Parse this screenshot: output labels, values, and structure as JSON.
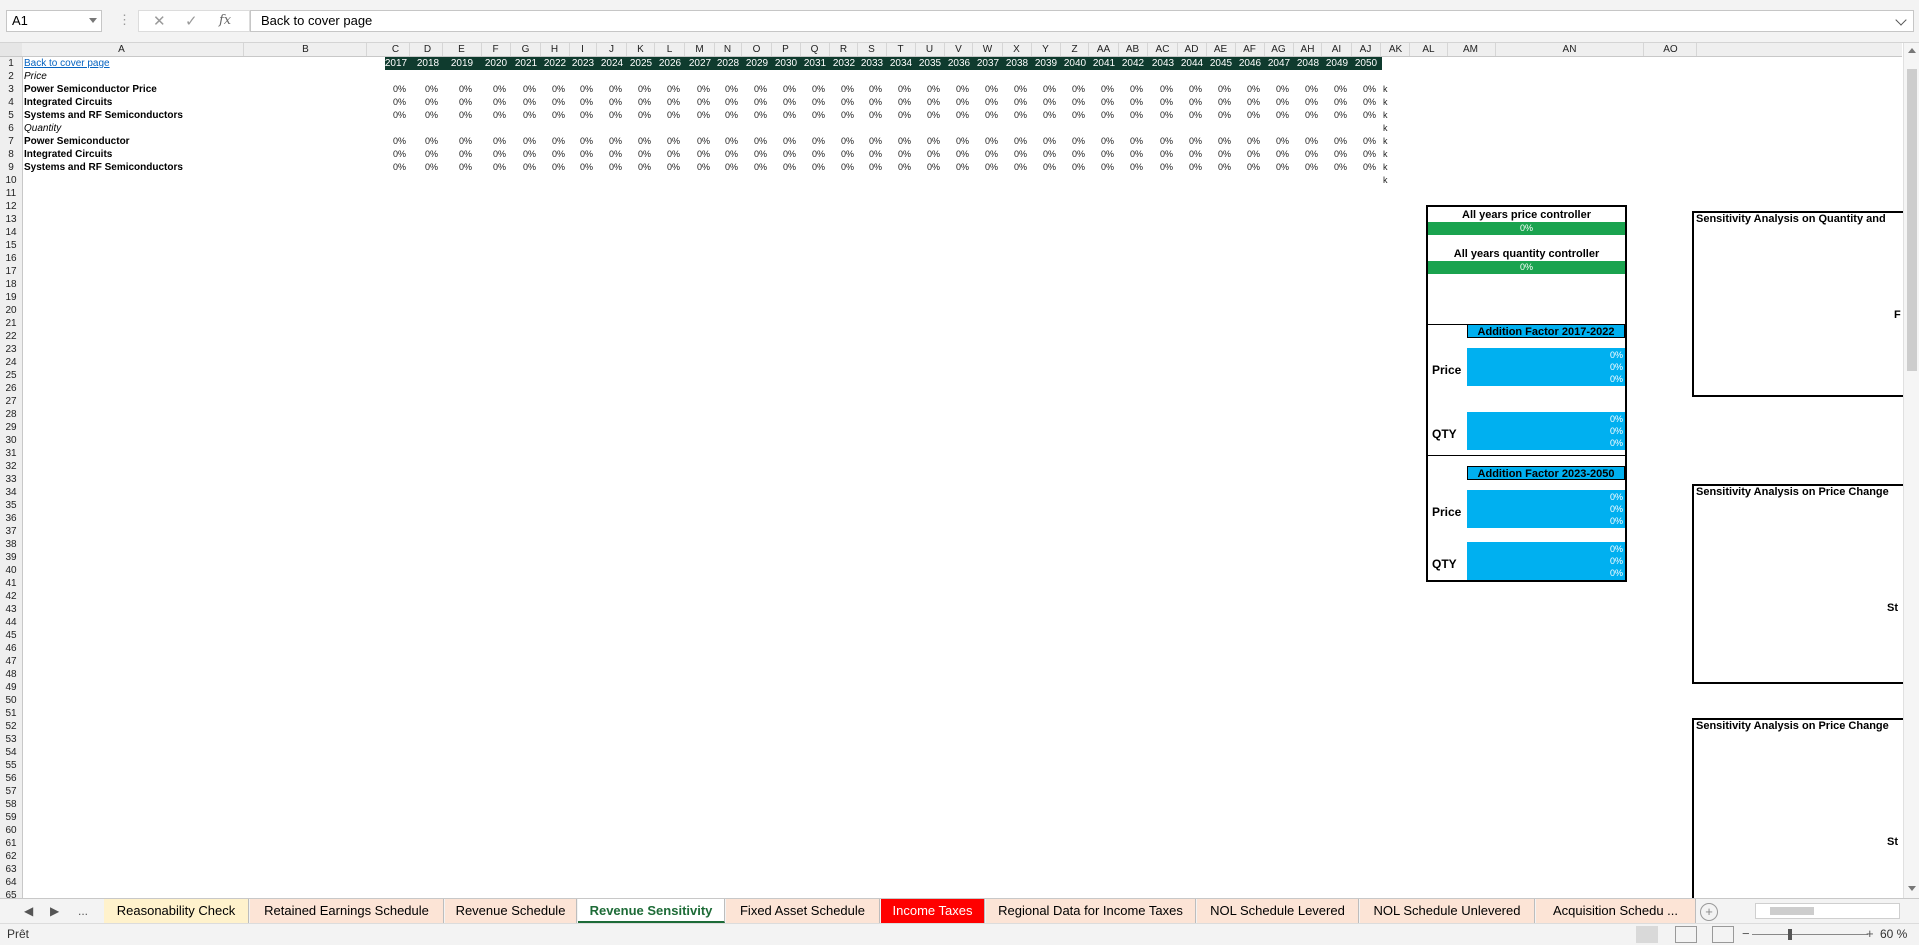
{
  "formula_bar": {
    "name_box": "A1",
    "separator": "⋮",
    "cancel_icon": "✕",
    "enter_icon": "✓",
    "fx_icon": "fx",
    "content": "Back to cover page"
  },
  "columns": [
    "A",
    "B",
    "C",
    "D",
    "E",
    "F",
    "G",
    "H",
    "I",
    "J",
    "K",
    "L",
    "M",
    "N",
    "O",
    "P",
    "Q",
    "R",
    "S",
    "T",
    "U",
    "V",
    "W",
    "X",
    "Y",
    "Z",
    "AA",
    "AB",
    "AC",
    "AD",
    "AE",
    "AF",
    "AG",
    "AH",
    "AI",
    "AJ",
    "AK",
    "AL",
    "AM",
    "AN",
    "AO"
  ],
  "rows": [
    "1",
    "2",
    "3",
    "4",
    "5",
    "6",
    "7",
    "8",
    "9",
    "10",
    "11",
    "12",
    "13",
    "14",
    "15",
    "16",
    "17",
    "18",
    "19",
    "20",
    "21",
    "22",
    "23",
    "24",
    "25",
    "26",
    "27",
    "28",
    "29",
    "30",
    "31",
    "32",
    "33",
    "34",
    "35",
    "36",
    "37",
    "38",
    "39",
    "40",
    "41",
    "42",
    "43",
    "44",
    "45",
    "46",
    "47",
    "48",
    "49",
    "50",
    "51",
    "52",
    "53",
    "54",
    "55",
    "56",
    "57",
    "58",
    "59",
    "60",
    "61",
    "62",
    "63",
    "64",
    "65"
  ],
  "years": [
    "2017",
    "2018",
    "2019",
    "2020",
    "2021",
    "2022",
    "2023",
    "2024",
    "2025",
    "2026",
    "2027",
    "2028",
    "2029",
    "2030",
    "2031",
    "2032",
    "2033",
    "2034",
    "2035",
    "2036",
    "2037",
    "2038",
    "2039",
    "2040",
    "2041",
    "2042",
    "2043",
    "2044",
    "2045",
    "2046",
    "2047",
    "2048",
    "2049",
    "2050"
  ],
  "labels": {
    "back_link": "Back to cover page",
    "price_section": "Price",
    "power_price": "Power Semiconductor Price",
    "ic": "Integrated Circuits",
    "systems_rf": "Systems and RF Semiconductors",
    "quantity_section": "Quantity",
    "power_qty": "Power Semiconductor",
    "ic_qty": "Integrated Circuits",
    "systems_rf_qty": "Systems and RF Semiconductors"
  },
  "zero_pct": "0%",
  "k_marker": "k",
  "controller": {
    "price_title": "All years price controller",
    "price_value": "0%",
    "qty_title": "All years quantity controller",
    "qty_value": "0%",
    "factor1_title": "Addition Factor 2017-2022",
    "factor2_title": "Addition Factor 2023-2050",
    "price_label": "Price",
    "qty_label": "QTY",
    "cell_value": "0%"
  },
  "sensitivity": {
    "panel1_title": "Sensitivity Analysis on Quantity and",
    "panel1_edge": "F",
    "panel2_title": "Sensitivity Analysis on Price Change",
    "panel2_edge": "St",
    "panel3_title": "Sensitivity Analysis on Price Change",
    "panel3_edge": "St"
  },
  "sheet_tabs": [
    {
      "label": "Reasonability Check",
      "color": "#fff2cc"
    },
    {
      "label": "Retained Earnings Schedule",
      "color": "#fce4d6"
    },
    {
      "label": "Revenue Schedule",
      "color": "#fce4d6"
    },
    {
      "label": "Revenue Sensitivity",
      "color": "#ffffff",
      "active": true
    },
    {
      "label": "Fixed Asset Schedule",
      "color": "#fce4d6"
    },
    {
      "label": "Income Taxes",
      "color": "#ff0000"
    },
    {
      "label": "Regional Data for Income Taxes",
      "color": "#fce4d6"
    },
    {
      "label": "NOL Schedule Levered",
      "color": "#fce4d6"
    },
    {
      "label": "NOL Schedule Unlevered",
      "color": "#fce4d6"
    },
    {
      "label": "Acquisition Schedu ...",
      "color": "#fce4d6"
    }
  ],
  "tab_nav": {
    "prev": "◀",
    "next": "▶",
    "more": "..."
  },
  "status": {
    "ready": "Prêt",
    "zoom": "60 %",
    "zoom_out": "−",
    "zoom_in": "+"
  }
}
